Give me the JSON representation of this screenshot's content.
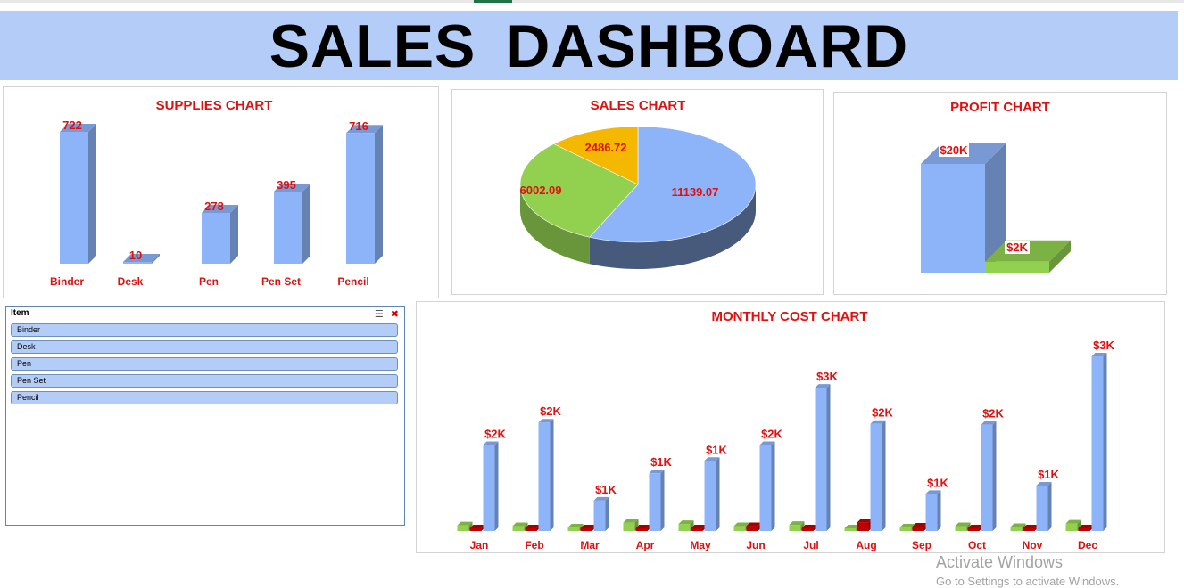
{
  "dashboard": {
    "title": "SALES  DASHBOARD"
  },
  "colors": {
    "blue": "#8db4f8",
    "green": "#92d050",
    "orange": "#f5b800",
    "red": "#c00000",
    "label_red": "#e01010",
    "banner": "#b4cdf8"
  },
  "chart_data": [
    {
      "type": "bar",
      "title": "SUPPLIES CHART",
      "categories": [
        "Binder",
        "Desk",
        "Pen",
        "Pen Set",
        "Pencil"
      ],
      "values": [
        722,
        10,
        278,
        395,
        716
      ],
      "ylim": [
        0,
        722
      ],
      "grid": false
    },
    {
      "type": "pie",
      "title": "SALES CHART",
      "values": [
        11139.07,
        6002.09,
        2486.72
      ],
      "value_labels": [
        "11139.07",
        "6002.09",
        "2486.72"
      ],
      "colors": [
        "#8db4f8",
        "#92d050",
        "#f5b800"
      ]
    },
    {
      "type": "bar",
      "title": "PROFIT CHART",
      "values": [
        20000,
        2000
      ],
      "value_labels": [
        "$20K",
        "$2K"
      ],
      "colors": [
        "#8db4f8",
        "#92d050"
      ]
    },
    {
      "type": "bar",
      "title": "MONTHLY COST CHART",
      "categories": [
        "Jan",
        "Feb",
        "Mar",
        "Apr",
        "May",
        "Jun",
        "Jul",
        "Aug",
        "Sep",
        "Oct",
        "Nov",
        "Dec"
      ],
      "series": [
        {
          "values": [
            130,
            110,
            80,
            190,
            160,
            110,
            140,
            60,
            80,
            110,
            90,
            170
          ],
          "color": "#92d050"
        },
        {
          "values": [
            40,
            50,
            30,
            35,
            30,
            110,
            40,
            190,
            100,
            40,
            40,
            40
          ],
          "color": "#c00000"
        },
        {
          "values": [
            1950,
            2460,
            690,
            1310,
            1590,
            1950,
            3250,
            2430,
            840,
            2410,
            1030,
            3960
          ],
          "color": "#8db4f8"
        }
      ],
      "value_labels": [
        "$2K",
        "$2K",
        "$1K",
        "$1K",
        "$1K",
        "$2K",
        "$3K",
        "$2K",
        "$1K",
        "$2K",
        "$1K",
        "$3K"
      ],
      "ylim": [
        0,
        3960
      ]
    }
  ],
  "slicer": {
    "header": "Item",
    "items": [
      "Binder",
      "Desk",
      "Pen",
      "Pen Set",
      "Pencil"
    ]
  },
  "watermark": {
    "line1": "Activate Windows",
    "line2": "Go to Settings to activate Windows."
  }
}
